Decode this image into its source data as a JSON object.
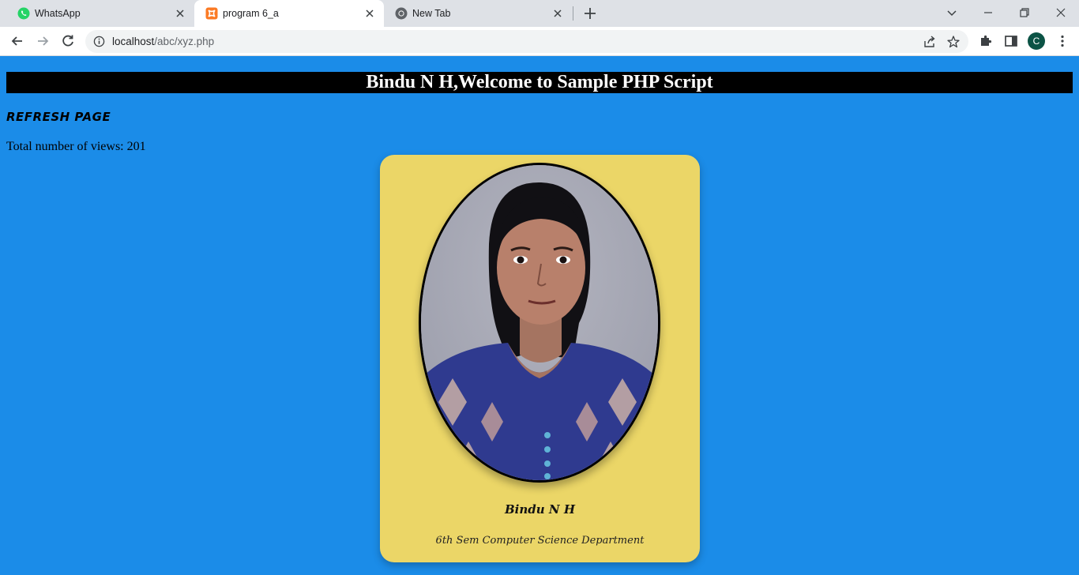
{
  "browser": {
    "tabs": [
      {
        "title": "WhatsApp",
        "icon": "whatsapp-icon",
        "active": false
      },
      {
        "title": "program 6_a",
        "icon": "xampp-icon",
        "active": true
      },
      {
        "title": "New Tab",
        "icon": "chrome-icon",
        "active": false
      }
    ],
    "url_host": "localhost",
    "url_path": "/abc/xyz.php",
    "profile_initial": "C"
  },
  "page": {
    "header": "Bindu N H,Welcome to Sample PHP Script",
    "refresh_label": "REFRESH PAGE",
    "views_label": "Total number of views: 201",
    "views_count": 201
  },
  "card": {
    "name": "Bindu N H",
    "department": "6th Sem Computer Science Department",
    "photo_icon": "profile-photo"
  },
  "colors": {
    "page_background": "#1b8ce8",
    "header_background": "#000000",
    "card_background": "#ebd667"
  }
}
